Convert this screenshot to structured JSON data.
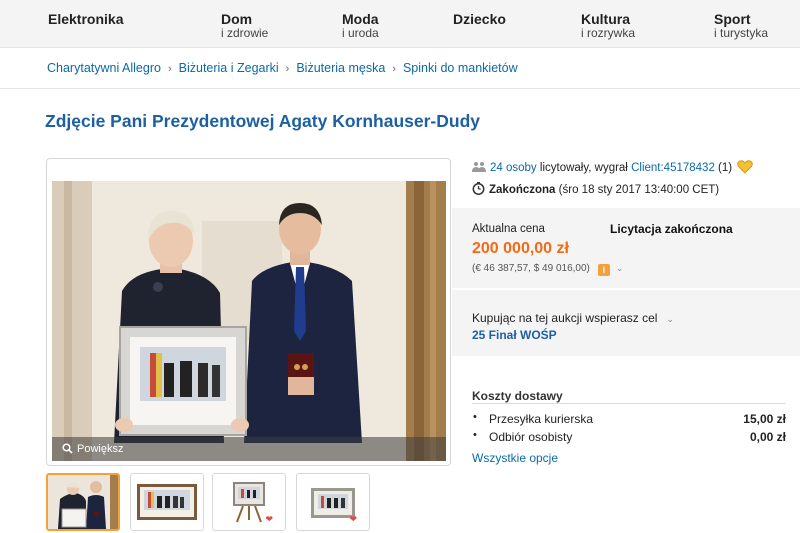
{
  "nav": {
    "categories": [
      {
        "line1": "Elektronika",
        "line2": ""
      },
      {
        "line1": "Dom",
        "line2": "i zdrowie"
      },
      {
        "line1": "Moda",
        "line2": "i uroda"
      },
      {
        "line1": "Dziecko",
        "line2": ""
      },
      {
        "line1": "Kultura",
        "line2": "i rozrywka"
      },
      {
        "line1": "Sport",
        "line2": "i turystyka"
      }
    ]
  },
  "breadcrumb": {
    "items": [
      "Charytatywni Allegro",
      "Biżuteria i Zegarki",
      "Biżuteria męska",
      "Spinki do mankietów"
    ],
    "separator": "›"
  },
  "title": "Zdjęcie Pani Prezydentowej Agaty Kornhauser-Dudy",
  "gallery": {
    "zoom_label": "Powiększ",
    "thumbnail_count": 4
  },
  "bidders": {
    "count_link": "24 osoby",
    "text_mid": "licytowały, wygrał",
    "winner": "Client:45178432",
    "winner_rating": "(1)"
  },
  "status": {
    "label": "Zakończona",
    "date": "(śro 18 sty 2017 13:40:00 CET)"
  },
  "price": {
    "label": "Aktualna cena",
    "value": "200 000,00 zł",
    "conversion": "(€ 46 387,57, $ 49 016,00)",
    "auction_status": "Licytacja zakończona"
  },
  "charity": {
    "label": "Kupując na tej aukcji wspierasz cel",
    "name": "25 Finał WOŚP"
  },
  "shipping": {
    "title": "Koszty dostawy",
    "rows": [
      {
        "name": "Przesyłka kurierska",
        "value": "15,00 zł"
      },
      {
        "name": "Odbiór osobisty",
        "value": "0,00 zł"
      }
    ],
    "all_options": "Wszystkie opcje"
  },
  "colors": {
    "link": "#0a6aa8",
    "title": "#1d5fa3",
    "price": "#f26b13",
    "accent": "#f3a23a"
  }
}
